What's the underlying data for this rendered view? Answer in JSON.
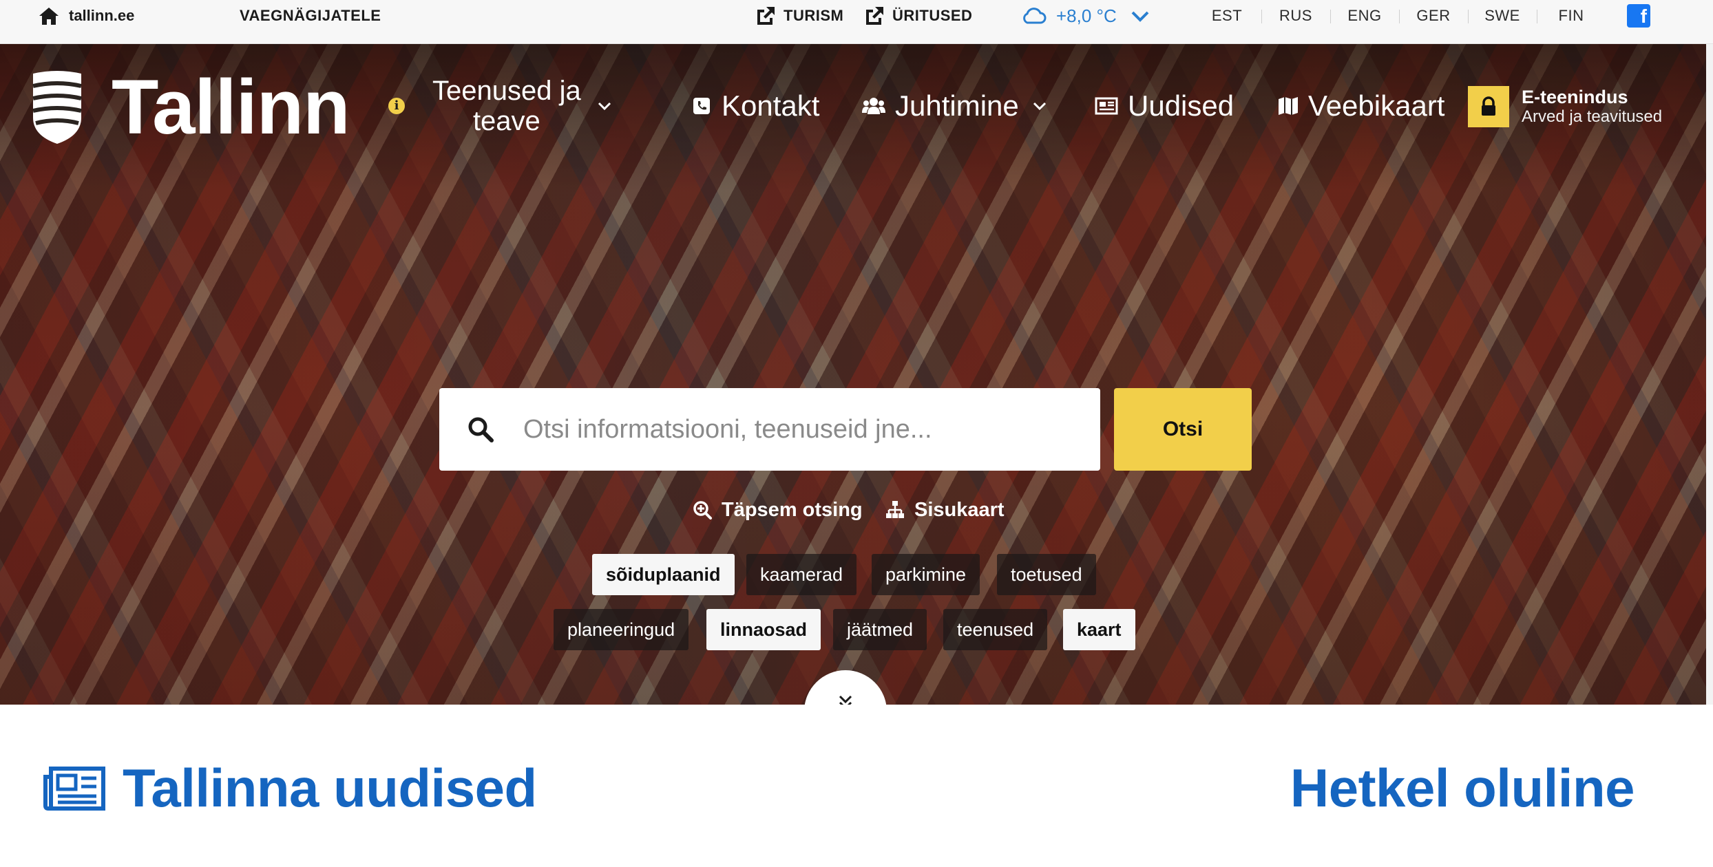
{
  "topbar": {
    "home_label": "tallinn.ee",
    "accessibility_label": "VAEGNÄGIJATELE",
    "tourism_label": "TURISM",
    "events_label": "ÜRITUSED",
    "weather_temp": "+8,0 °C",
    "languages": [
      "EST",
      "RUS",
      "ENG",
      "GER",
      "SWE",
      "FIN"
    ],
    "facebook_icon": "facebook-icon"
  },
  "header": {
    "logo_text": "Tallinn",
    "nav": {
      "services_line1": "Teenused ja",
      "services_line2": "teave",
      "contact": "Kontakt",
      "management": "Juhtimine",
      "news": "Uudised",
      "webmap": "Veebikaart"
    },
    "eservice": {
      "title": "E-teenindus",
      "subtitle": "Arved ja teavitused"
    }
  },
  "search": {
    "placeholder": "Otsi informatsiooni, teenuseid jne...",
    "button_label": "Otsi",
    "advanced_label": "Täpsem otsing",
    "sitemap_label": "Sisukaart",
    "tags_row1": [
      "sõiduplaanid",
      "kaamerad",
      "parkimine",
      "toetused"
    ],
    "tags_row2": [
      "planeeringud",
      "linnaosad",
      "jäätmed",
      "teenused",
      "kaart"
    ]
  },
  "content": {
    "news_title": "Tallinna uudised",
    "important_title": "Hetkel oluline"
  },
  "colors": {
    "accent_yellow": "#f2cf4a",
    "brand_blue": "#1565c0",
    "weather_blue": "#2a7fd0"
  }
}
